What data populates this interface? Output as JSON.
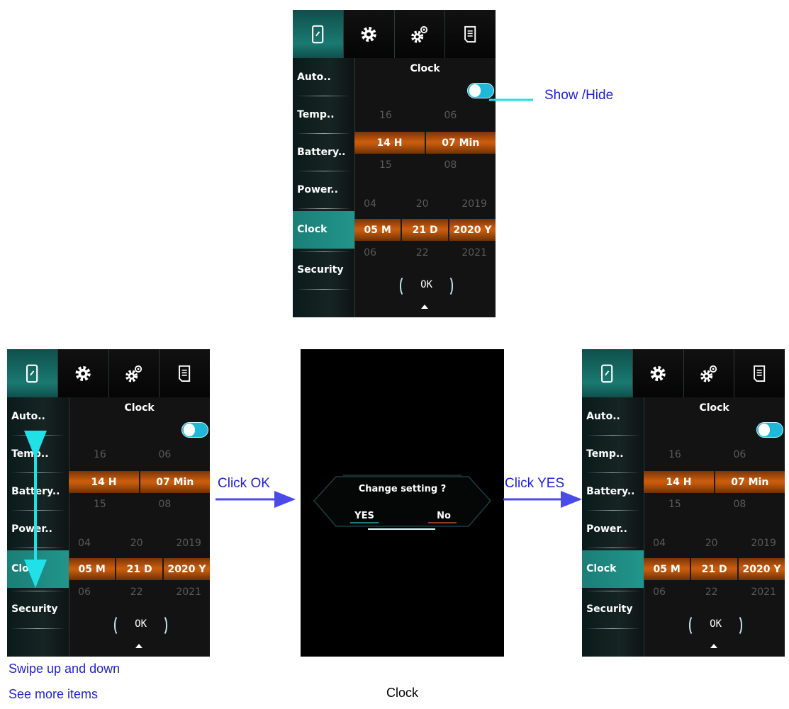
{
  "screen": {
    "tabs": [
      {
        "icon": "phone-icon",
        "active": true
      },
      {
        "icon": "gear-icon",
        "active": false
      },
      {
        "icon": "gears-icon",
        "active": false
      },
      {
        "icon": "document-icon",
        "active": false
      }
    ],
    "sidebar_items": [
      "Auto..",
      "Temp..",
      "Battery..",
      "Power..",
      "Clock",
      "Security"
    ],
    "selected_item": "Clock",
    "title": "Clock",
    "toggle_on": true,
    "time_above": [
      "16",
      "06"
    ],
    "time_selected": [
      "14 H",
      "07 Min"
    ],
    "time_below": [
      "15",
      "08"
    ],
    "date_above": [
      "04",
      "20",
      "2019"
    ],
    "date_selected": [
      "05 M",
      "21 D",
      "2020 Y"
    ],
    "date_below": [
      "06",
      "22",
      "2021"
    ],
    "ok_label": "OK"
  },
  "dialog": {
    "question": "Change setting ?",
    "yes": "YES",
    "no": "No"
  },
  "annotations": {
    "show_hide": "Show /Hide",
    "click_ok": "Click OK",
    "click_yes": "Click YES",
    "swipe_line1": "Swipe up and down",
    "swipe_line2": "See more items",
    "caption": "Clock"
  },
  "colors": {
    "teal_accent": "#1a7a72",
    "orange_band": "#c45a0d",
    "toggle": "#1fb8d8",
    "annotation_text": "#1f1fd6",
    "arrow_blue": "#4a4ae8",
    "arrow_cyan": "#22e0e8"
  }
}
